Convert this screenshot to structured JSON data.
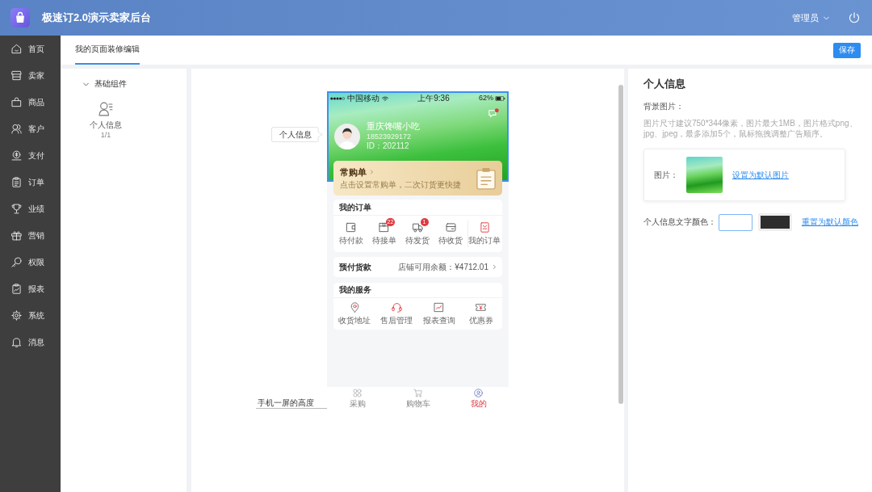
{
  "header": {
    "title": "极速订2.0演示卖家后台",
    "user": "管理员"
  },
  "sidebar": {
    "items": [
      {
        "label": "首页"
      },
      {
        "label": "卖家"
      },
      {
        "label": "商品"
      },
      {
        "label": "客户"
      },
      {
        "label": "支付"
      },
      {
        "label": "订单"
      },
      {
        "label": "业绩"
      },
      {
        "label": "营销"
      },
      {
        "label": "权限"
      },
      {
        "label": "报表"
      },
      {
        "label": "系统"
      },
      {
        "label": "消息"
      }
    ]
  },
  "tabs": [
    {
      "label": "我的页面装修编辑",
      "selected": true
    }
  ],
  "save_button": "保存",
  "components_panel": {
    "group": {
      "label": "基础组件",
      "expanded": true
    },
    "items": [
      {
        "label": "个人信息",
        "count": "1/1"
      }
    ]
  },
  "preview": {
    "component_label": "个人信息",
    "screen_height_label": "手机一屏的高度",
    "phone": {
      "status_bar": {
        "carrier": "中国移动",
        "time": "上午9:36",
        "battery": "62%"
      },
      "profile": {
        "selected": true,
        "name": "重庆馋嘴小吃",
        "phone": "18523929172",
        "id": "ID：202112"
      },
      "frequent_order": {
        "title": "常购单",
        "subtitle": "点击设置常购单，二次订货更快捷"
      },
      "orders": {
        "title": "我的订单",
        "items": [
          {
            "kind": "status",
            "label": "待付款"
          },
          {
            "kind": "status",
            "label": "待接单",
            "badge": "22"
          },
          {
            "kind": "status",
            "label": "待发货",
            "badge": "1"
          },
          {
            "kind": "status",
            "label": "待收货"
          },
          {
            "kind": "all",
            "label": "我的订单"
          }
        ]
      },
      "prepaid": {
        "title": "预付货款",
        "balance": "店铺可用余额：¥4712.01"
      },
      "services": {
        "title": "我的服务",
        "items": [
          {
            "label": "收货地址"
          },
          {
            "label": "售后管理"
          },
          {
            "label": "报表查询"
          },
          {
            "label": "优惠券"
          }
        ]
      },
      "bottom_nav": [
        {
          "label": "采购",
          "selected": false
        },
        {
          "label": "购物车",
          "selected": false
        },
        {
          "label": "我的",
          "selected": true
        }
      ]
    }
  },
  "settings": {
    "title": "个人信息",
    "background_label": "背景图片：",
    "hint": "图片尺寸建议750*344像素，图片最大1MB，图片格式png、jpg、jpeg，最多添加5个，鼠标拖拽调整广告顺序。",
    "image_card": {
      "label": "图片：",
      "link": "设置为默认图片"
    },
    "text_color": {
      "label": "个人信息文字颜色：",
      "color": "#2e2e2e",
      "reset_link": "重置为默认颜色"
    }
  }
}
